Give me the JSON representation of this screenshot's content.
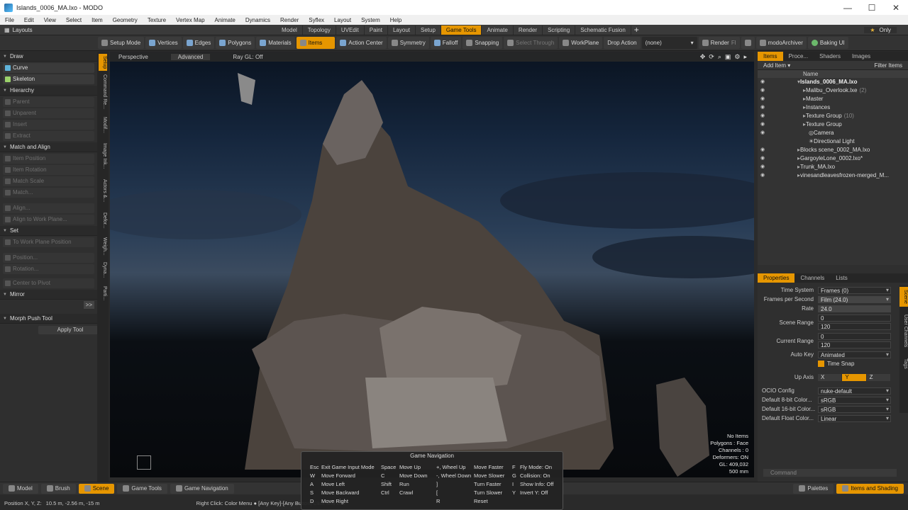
{
  "window": {
    "title": "Islands_0006_MA.lxo - MODO",
    "controls": [
      "—",
      "☐",
      "✕"
    ]
  },
  "menu": [
    "File",
    "Edit",
    "View",
    "Select",
    "Item",
    "Geometry",
    "Texture",
    "Vertex Map",
    "Animate",
    "Dynamics",
    "Render",
    "Syflex",
    "Layout",
    "System",
    "Help"
  ],
  "layoutbar": {
    "layouts_label": "Layouts",
    "tabs": [
      "Model",
      "Topology",
      "UVEdit",
      "Paint",
      "Layout",
      "Setup",
      "Game Tools",
      "Animate",
      "Render",
      "Scripting",
      "Schematic Fusion"
    ],
    "active_tab": "Game Tools",
    "only_label": "Only"
  },
  "toolbar": {
    "setup_mode": "Setup Mode",
    "vertices": "Vertices",
    "edges": "Edges",
    "polygons": "Polygons",
    "materials": "Materials",
    "items": "Items",
    "action_center": "Action Center",
    "symmetry": "Symmetry",
    "falloff": "Falloff",
    "snapping": "Snapping",
    "select_through": "Select Through",
    "workplane": "WorkPlane",
    "drop_action": "Drop Action",
    "drop_value": "(none)",
    "render": "Render",
    "render_suffix": "Fl",
    "modo_archiver": "modoArchiver",
    "baking_ui": "Baking UI"
  },
  "left_panel": {
    "draw": "Draw",
    "curve": "Curve",
    "skeleton": "Skeleton",
    "hierarchy": "Hierarchy",
    "parent": "Parent",
    "unparent": "Unparent",
    "insert": "Insert",
    "extract": "Extract",
    "match_align": "Match and Align",
    "item_position": "Item Position",
    "item_rotation": "Item Rotation",
    "match_scale": "Match Scale",
    "match": "Match...",
    "align": "Align...",
    "align_wp": "Align to Work Plane...",
    "set": "Set",
    "to_wp_pos": "To Work Plane Position",
    "position": "Position...",
    "rotation": "Rotation...",
    "center_pivot": "Center to Pivot",
    "mirror": "Mirror",
    "more": ">>",
    "morph_push": "Morph Push Tool",
    "apply_tool": "Apply Tool"
  },
  "vtabs": [
    "Setup",
    "Command Re...",
    "Modif...",
    "Image Ink...",
    "Actors &...",
    "Defor...",
    "Weigh...",
    "Dyna...",
    "Parti..."
  ],
  "viewport": {
    "perspective": "Perspective",
    "advanced": "Advanced",
    "raygl": "Ray GL: Off",
    "icons": [
      "✥",
      "⟳",
      "⌕",
      "▣",
      "⚙",
      "▸"
    ],
    "hud": [
      "No Items",
      "Polygons : Face",
      "Channels : 0",
      "Deformers: ON",
      "GL: 409,032",
      "500 mm"
    ]
  },
  "items_panel": {
    "tabs": [
      "Items",
      "Proce...",
      "Shaders",
      "Images"
    ],
    "add_item": "Add Item",
    "filter_items": "Filter Items",
    "name_header": "Name",
    "tree": [
      {
        "label": "Islands_0006_MA.lxo",
        "bold": true,
        "count": ""
      },
      {
        "label": "Malibu_Overlook.lxe",
        "bold": false,
        "count": "(2)"
      },
      {
        "label": "Master",
        "bold": false,
        "count": ""
      },
      {
        "label": "Instances",
        "bold": false,
        "count": ""
      },
      {
        "label": "Texture Group",
        "bold": false,
        "count": "(10)"
      },
      {
        "label": "Texture Group",
        "bold": false,
        "count": ""
      },
      {
        "label": "Camera",
        "bold": false,
        "count": ""
      },
      {
        "label": "Directional Light",
        "bold": false,
        "count": ""
      },
      {
        "label": "Blocks scene_0002_MA.lxo",
        "bold": false,
        "count": ""
      },
      {
        "label": "GargoyleLone_0002.lxo*",
        "bold": false,
        "count": ""
      },
      {
        "label": "Trunk_MA.lxo",
        "bold": false,
        "count": ""
      },
      {
        "label": "vinesandleavesfrozen-merged_M...",
        "bold": false,
        "count": ""
      }
    ]
  },
  "properties_panel": {
    "tabs": [
      "Properties",
      "Channels",
      "Lists"
    ],
    "time_system": {
      "label": "Time System",
      "value": "Frames (0)"
    },
    "fps": {
      "label": "Frames per Second",
      "value": "Film (24.0)"
    },
    "rate": {
      "label": "Rate",
      "value": "24.0"
    },
    "scene_range": {
      "label": "Scene Range",
      "start": "0",
      "end": "120"
    },
    "current_range": {
      "label": "Current Range",
      "start": "0",
      "end": "120"
    },
    "auto_key": {
      "label": "Auto Key",
      "value": "Animated"
    },
    "time_snap": "Time Snap",
    "up_axis": {
      "label": "Up Axis",
      "x": "X",
      "y": "Y",
      "z": "Z"
    },
    "ocio": {
      "label": "OCIO Config",
      "value": "nuke-default"
    },
    "color8": {
      "label": "Default 8-bit Color...",
      "value": "sRGB"
    },
    "color16": {
      "label": "Default 16-bit Color...",
      "value": "sRGB"
    },
    "colorf": {
      "label": "Default Float Color...",
      "value": "Linear"
    },
    "command": "Command",
    "side_tabs": [
      "Scene",
      "User Channels",
      "Tags"
    ]
  },
  "bottom_bar": {
    "model": "Model",
    "brush": "Brush",
    "scene": "Scene",
    "game_tools": "Game Tools",
    "game_nav": "Game Navigation",
    "palettes": "Palettes",
    "items_shading": "Items and Shading"
  },
  "status": {
    "position_label": "Position X, Y, Z:",
    "position_value": "10.5 m, -2.56 m, -15 m",
    "hint": "Right Click: Color Menu ● [Any Key]-[Any Button] Click and Dra"
  },
  "game_nav": {
    "title": "Game Navigation",
    "col1_keys": [
      "Esc",
      "W",
      "A",
      "S",
      "D"
    ],
    "col1_actions": [
      "Exit Game Input Mode",
      "Move Forward",
      "Move Left",
      "Move Backward",
      "Move Right"
    ],
    "col2_keys": [
      "Space",
      "C",
      "Shift",
      "Ctrl",
      ""
    ],
    "col2_actions": [
      "Move Up",
      "Move Down",
      "Run",
      "Crawl",
      ""
    ],
    "col3_keys": [
      "+, Wheel Up",
      "-, Wheel Down",
      "]",
      "[",
      "R"
    ],
    "col3_actions": [
      "Move Faster",
      "Move Slower",
      "Turn Faster",
      "Turn Slower",
      "Reset"
    ],
    "col4_keys": [
      "F",
      "G",
      "I",
      "Y",
      ""
    ],
    "col4_actions": [
      "Fly Mode: On",
      "Collision: On",
      "Show Info: Off",
      "Invert Y: Off",
      ""
    ]
  }
}
